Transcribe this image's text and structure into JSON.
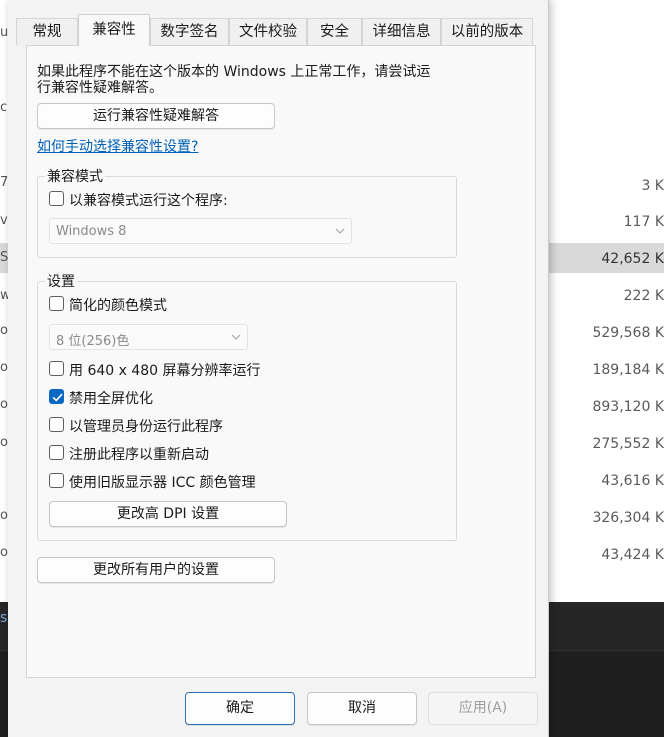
{
  "background_list": {
    "edge_chars": [
      "u",
      "c",
      "7",
      "v",
      "S",
      "w",
      "o",
      "o",
      "o",
      "o",
      "o",
      "o"
    ],
    "sizes": [
      "3 K",
      "117 K",
      "42,652 K",
      "222 K",
      "529,568 K",
      "189,184 K",
      "893,120 K",
      "275,552 K",
      "43,616 K",
      "326,304 K",
      "43,424 K"
    ],
    "selected_size": "42,652 K",
    "bottom_char": "s"
  },
  "tabs": [
    {
      "label": "常规"
    },
    {
      "label": "兼容性"
    },
    {
      "label": "数字签名"
    },
    {
      "label": "文件校验"
    },
    {
      "label": "安全"
    },
    {
      "label": "详细信息"
    },
    {
      "label": "以前的版本"
    }
  ],
  "active_tab": "兼容性",
  "intro": {
    "line1": "如果此程序不能在这个版本的 Windows 上正常工作，请尝试运",
    "line2": "行兼容性疑难解答。"
  },
  "troubleshoot_button": "运行兼容性疑难解答",
  "manual_link": "如何手动选择兼容性设置?",
  "compat_mode": {
    "legend": "兼容模式",
    "checkbox_label": "以兼容模式运行这个程序:",
    "checked": false,
    "select_value": "Windows 8"
  },
  "settings": {
    "legend": "设置",
    "reduced_color": {
      "label": "简化的颜色模式",
      "checked": false
    },
    "color_select_value": "8 位(256)色",
    "res_640": {
      "label": "用 640 x 480 屏幕分辨率运行",
      "checked": false
    },
    "disable_fullscreen": {
      "label": "禁用全屏优化",
      "checked": true
    },
    "run_admin": {
      "label": "以管理员身份运行此程序",
      "checked": false
    },
    "register_restart": {
      "label": "注册此程序以重新启动",
      "checked": false
    },
    "legacy_icc": {
      "label": "使用旧版显示器 ICC 颜色管理",
      "checked": false
    },
    "dpi_button": "更改高 DPI 设置"
  },
  "all_users_button": "更改所有用户的设置",
  "footer": {
    "ok": "确定",
    "cancel": "取消",
    "apply": "应用(A)"
  },
  "colors": {
    "accent": "#0a67c2",
    "link": "#0060b8",
    "dialog_bg": "#f3f3f3",
    "panel_bg": "#f9f9f9"
  }
}
